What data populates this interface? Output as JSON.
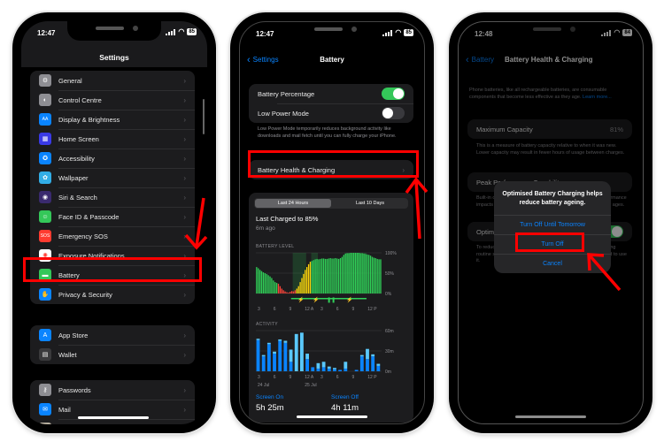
{
  "colors": {
    "highlight": "#ff0000",
    "ios_blue": "#0a84ff",
    "ios_green": "#34c759",
    "battery_green": "#30d158",
    "battery_red": "#ff453a",
    "battery_yellow": "#ffd60a",
    "activity_dark": "#0a84ff",
    "activity_light": "#5ac8fa"
  },
  "phone1": {
    "status": {
      "time": "12:47",
      "battery": "85"
    },
    "title": "Settings",
    "groups": [
      [
        {
          "label": "General",
          "icon": "gear-icon",
          "color": "#8e8e93",
          "glyph": "⚙"
        },
        {
          "label": "Control Centre",
          "icon": "toggles-icon",
          "color": "#8e8e93",
          "glyph": "◐"
        },
        {
          "label": "Display & Brightness",
          "icon": "text-size-icon",
          "color": "#0a84ff",
          "glyph": "AA"
        },
        {
          "label": "Home Screen",
          "icon": "home-grid-icon",
          "color": "#3a3ae6",
          "glyph": "▦"
        },
        {
          "label": "Accessibility",
          "icon": "accessibility-icon",
          "color": "#0a84ff",
          "glyph": "✪"
        },
        {
          "label": "Wallpaper",
          "icon": "wallpaper-flower-icon",
          "color": "#32ade6",
          "glyph": "✿"
        },
        {
          "label": "Siri & Search",
          "icon": "siri-icon",
          "color": "#3a2a6e",
          "glyph": "◉"
        },
        {
          "label": "Face ID & Passcode",
          "icon": "face-id-icon",
          "color": "#34c759",
          "glyph": "☺"
        },
        {
          "label": "Emergency SOS",
          "icon": "sos-icon",
          "color": "#ff3b30",
          "glyph": "SOS"
        },
        {
          "label": "Exposure Notifications",
          "icon": "exposure-icon",
          "color": "#ffffff",
          "glyph": "✺"
        },
        {
          "label": "Battery",
          "icon": "battery-icon",
          "color": "#34c759",
          "glyph": "▬"
        },
        {
          "label": "Privacy & Security",
          "icon": "hand-icon",
          "color": "#0a84ff",
          "glyph": "✋"
        }
      ],
      [
        {
          "label": "App Store",
          "icon": "app-store-icon",
          "color": "#0a84ff",
          "glyph": "A"
        },
        {
          "label": "Wallet",
          "icon": "wallet-icon",
          "color": "#3a3a3c",
          "glyph": "▤"
        }
      ],
      [
        {
          "label": "Passwords",
          "icon": "key-icon",
          "color": "#8e8e93",
          "glyph": "⚷"
        },
        {
          "label": "Mail",
          "icon": "mail-icon",
          "color": "#0a84ff",
          "glyph": "✉"
        },
        {
          "label": "Contacts",
          "icon": "contacts-icon",
          "color": "#b8b0a0",
          "glyph": "◙"
        }
      ]
    ],
    "chevron": "›"
  },
  "phone2": {
    "status": {
      "time": "12:47",
      "battery": "85"
    },
    "back_label": "Settings",
    "title": "Battery",
    "toggles": [
      {
        "label": "Battery Percentage",
        "on": true
      },
      {
        "label": "Low Power Mode",
        "on": false
      }
    ],
    "low_power_note": "Low Power Mode temporarily reduces background activity like downloads and mail fetch until you can fully charge your iPhone.",
    "health_row": "Battery Health & Charging",
    "chevron": "›",
    "tabs": [
      "Last 24 Hours",
      "Last 10 Days"
    ],
    "active_tab": 0,
    "last_charged": "Last Charged to 85%",
    "last_charged_ago": "6m ago",
    "battery_chart": {
      "label": "BATTERY LEVEL",
      "y_ticks": [
        "100%",
        "50%",
        "0%"
      ],
      "x_ticks": [
        "3",
        "6",
        "9",
        "12 A",
        "3",
        "6",
        "9",
        "12 P"
      ]
    },
    "activity_chart": {
      "label": "ACTIVITY",
      "y_ticks": [
        "60m",
        "30m",
        "0m"
      ],
      "x_ticks": [
        "3",
        "6",
        "9",
        "12 A",
        "3",
        "6",
        "9",
        "12 P"
      ],
      "dates": [
        "24 Jul",
        "25 Jul"
      ]
    },
    "screen_on_label": "Screen On",
    "screen_on_value": "5h 25m",
    "screen_off_label": "Screen Off",
    "screen_off_value": "4h 11m"
  },
  "chart_data": [
    {
      "type": "bar",
      "title": "BATTERY LEVEL",
      "ylabel": "",
      "ylim": [
        0,
        100
      ],
      "x_ticks": [
        "3",
        "6",
        "9",
        "12 A",
        "3",
        "6",
        "9",
        "12 P"
      ],
      "values": [
        65,
        62,
        58,
        55,
        52,
        50,
        48,
        45,
        42,
        38,
        32,
        28,
        26,
        24,
        18,
        12,
        8,
        5,
        3,
        2,
        4,
        6,
        5,
        8,
        12,
        18,
        28,
        38,
        48,
        58,
        65,
        72,
        78,
        80,
        82,
        84,
        85,
        84,
        85,
        86,
        86,
        85,
        85,
        86,
        87,
        86,
        86,
        87,
        86,
        85,
        87,
        90,
        95,
        98,
        99,
        99,
        100,
        100,
        100,
        100,
        100,
        100,
        99,
        99,
        98,
        97,
        96,
        95,
        93,
        90,
        88,
        87,
        85,
        84,
        84
      ],
      "color_zones": {
        "red_below": 25,
        "yellow_charging_range": [
          25,
          33
        ]
      }
    },
    {
      "type": "bar",
      "title": "ACTIVITY",
      "ylim": [
        0,
        60
      ],
      "y_units": "minutes",
      "x_ticks": [
        "3",
        "6",
        "9",
        "12 A",
        "3",
        "6",
        "9",
        "12 P"
      ],
      "series": [
        {
          "name": "Screen On",
          "values": [
            46,
            22,
            40,
            26,
            45,
            42,
            14,
            0,
            0,
            18,
            6,
            4,
            6,
            4,
            3,
            2,
            4,
            0,
            2,
            22,
            18,
            22,
            8
          ]
        },
        {
          "name": "Screen Off",
          "values": [
            2,
            2,
            2,
            3,
            2,
            3,
            18,
            55,
            57,
            8,
            0,
            8,
            8,
            3,
            2,
            0,
            10,
            0,
            0,
            2,
            15,
            3,
            3
          ]
        }
      ]
    }
  ],
  "phone3": {
    "status": {
      "time": "12:48",
      "battery": "84"
    },
    "back_label": "Battery",
    "title": "Battery Health & Charging",
    "intro": "Phone batteries, like all rechargeable batteries, are consumable components that become less effective as they age.",
    "learn_more": "Learn more...",
    "max_capacity_label": "Maximum Capacity",
    "max_capacity_value": "81%",
    "capacity_note": "This is a measure of battery capacity relative to when it was new. Lower capacity may result in fewer hours of usage between charges.",
    "peak_label": "Peak Performance Capability",
    "peak_note": "Built-in dynamic software and hardware will help counter performance impacts that may be noticed as your iPhone battery chemically ages.",
    "optimised_label": "Optimised Battery Charging",
    "optimised_note": "To reduce battery ageing, iPhone learns from your daily charging routine so it can wait to finish charging past 80% until you need to use it.",
    "alert": {
      "message": "Optimised Battery Charging helps reduce battery ageing.",
      "buttons": [
        "Turn Off Until Tomorrow",
        "Turn Off",
        "Cancel"
      ]
    }
  }
}
